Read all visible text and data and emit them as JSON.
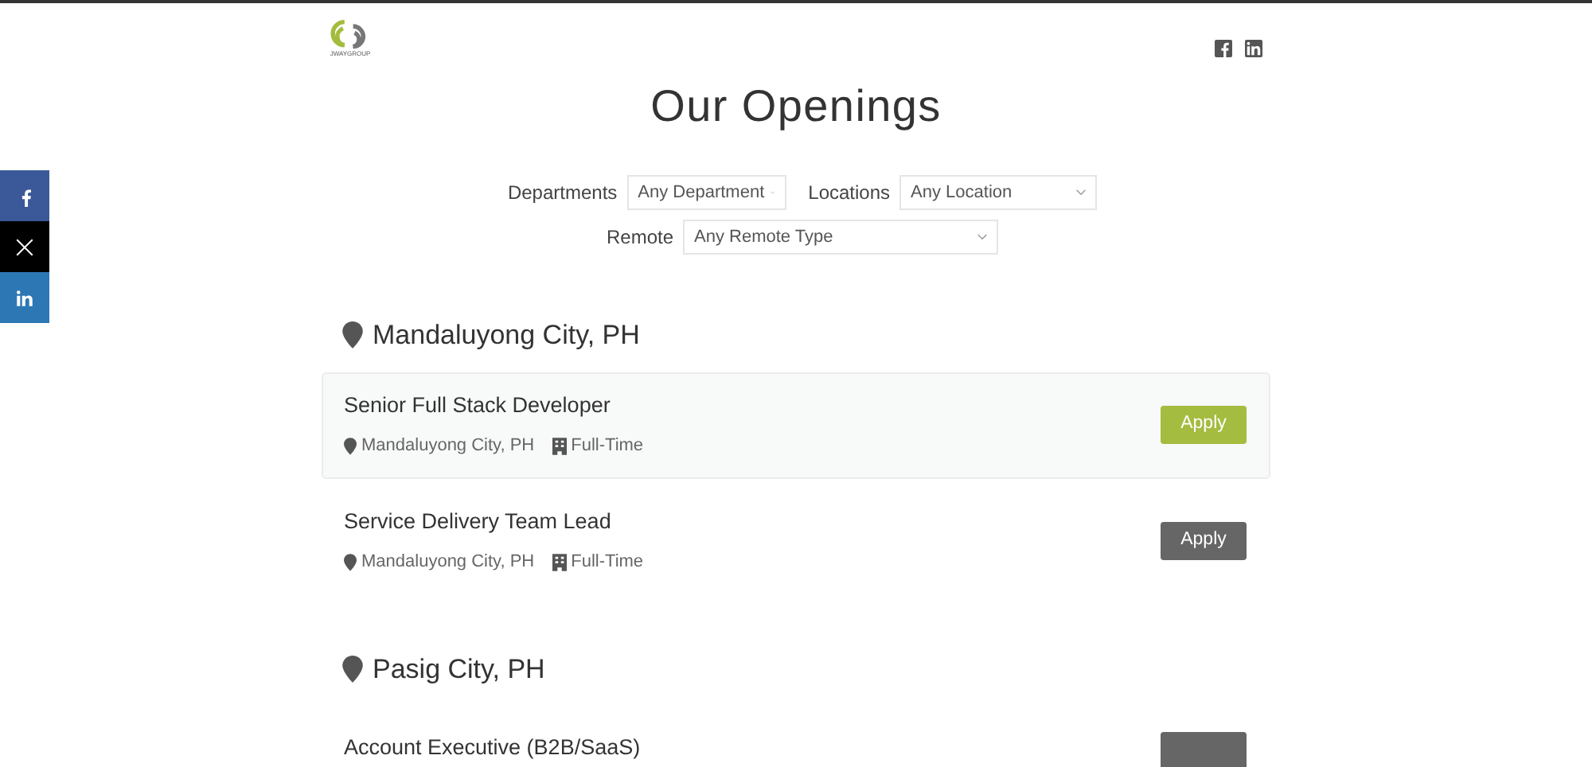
{
  "logo": {
    "text": "JWAYGROUP"
  },
  "social_header": [
    {
      "kind": "facebook"
    },
    {
      "kind": "linkedin"
    }
  ],
  "share_bar": [
    {
      "kind": "facebook",
      "color": "#3b5998"
    },
    {
      "kind": "x",
      "color": "#000000"
    },
    {
      "kind": "linkedin",
      "color": "#2d77b4"
    }
  ],
  "title": "Our Openings",
  "filters": [
    {
      "label": "Departments",
      "value": "Any Department"
    },
    {
      "label": "Locations",
      "value": "Any Location"
    },
    {
      "label": "Remote",
      "value": "Any Remote Type"
    }
  ],
  "sections": [
    {
      "location": "Mandaluyong City, PH",
      "jobs": [
        {
          "title": "Senior Full Stack Developer",
          "location": "Mandaluyong City, PH",
          "type": "Full-Time",
          "apply": "Apply",
          "selected": true
        },
        {
          "title": "Service Delivery Team Lead",
          "location": "Mandaluyong City, PH",
          "type": "Full-Time",
          "apply": "Apply",
          "selected": false
        }
      ]
    },
    {
      "location": "Pasig City, PH",
      "jobs": [
        {
          "title": "Account Executive (B2B/SaaS)",
          "selected": false
        }
      ]
    }
  ]
}
